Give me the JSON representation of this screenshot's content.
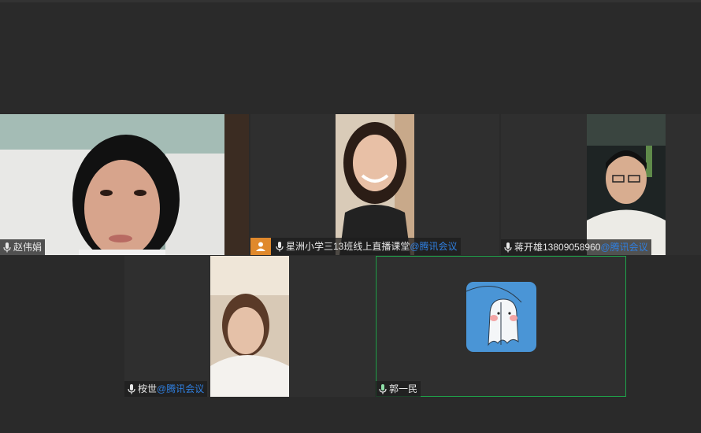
{
  "meeting": {
    "participants": [
      {
        "name": "赵伟娟",
        "tag": ""
      },
      {
        "name": "星洲小学三13班线上直播课堂",
        "tag": "@腾讯会议"
      },
      {
        "name": "蒋开雄13809058960",
        "tag": "@腾讯会议"
      },
      {
        "name": "桉世",
        "tag": "@腾讯会议"
      },
      {
        "name": "郭一民",
        "tag": ""
      }
    ]
  },
  "icons": {
    "mic": "microphone-icon",
    "user_badge": "user-badge-icon",
    "avatar": "ghost-sticker-avatar"
  },
  "colors": {
    "active_speaker_border": "#1fa34a",
    "brand_tag": "#2f7fe0",
    "badge_orange": "#e0892c",
    "avatar_bg": "#4a95d6"
  }
}
